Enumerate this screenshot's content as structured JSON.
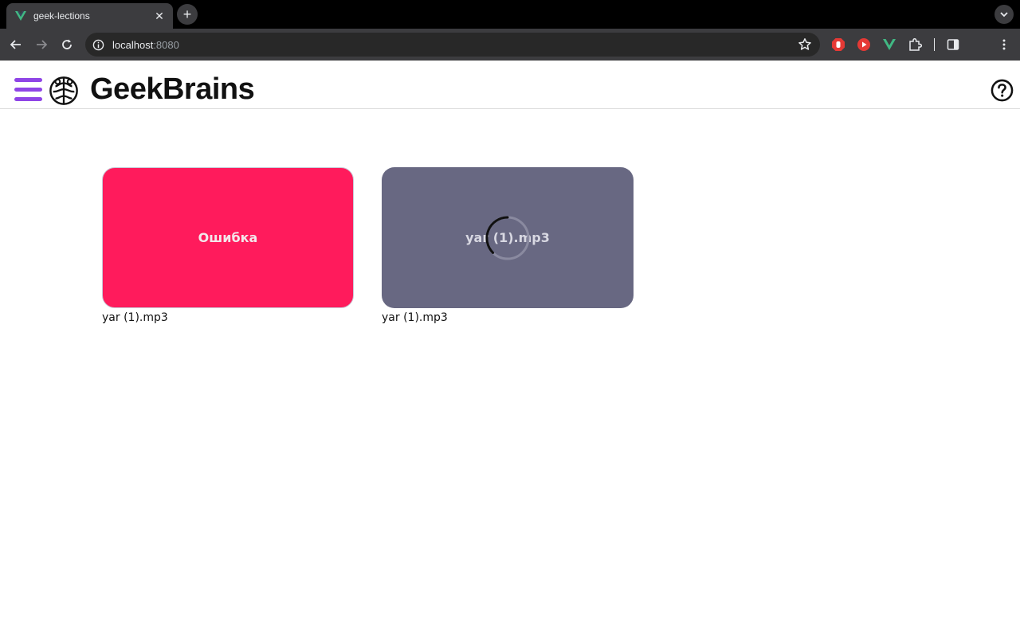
{
  "browser": {
    "tab_title": "geek-lections",
    "url_host": "localhost",
    "url_port": ":8080"
  },
  "header": {
    "brand": "GeekBrains",
    "accent_color": "#8f45e6"
  },
  "cards": [
    {
      "label": "Ошибка",
      "state": "error",
      "color": "#ff1b5c",
      "caption": "yar (1).mp3"
    },
    {
      "label": "yar (1).mp3",
      "state": "loading",
      "color": "#686882",
      "caption": "yar (1).mp3"
    }
  ]
}
